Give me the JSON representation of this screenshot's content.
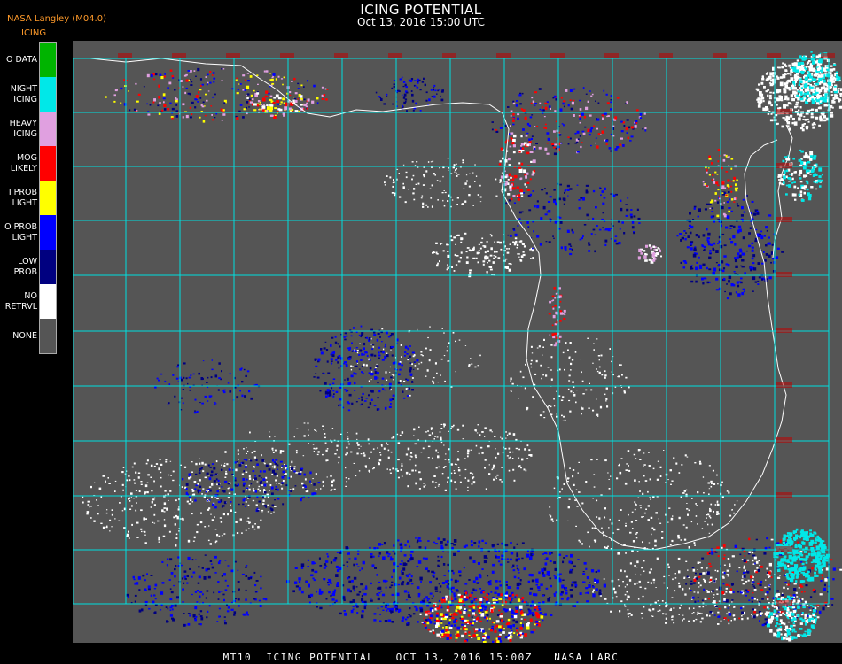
{
  "header": {
    "title": "ICING POTENTIAL",
    "subtitle": "Oct 13, 2016 15:00 UTC",
    "producer": "NASA Langley (M04.0)",
    "product": "ICING"
  },
  "legend": [
    {
      "label": "O DATA",
      "color": "#00b400"
    },
    {
      "label": "NIGHT\nICING",
      "color": "#00e8e8"
    },
    {
      "label": "HEAVY\nICING",
      "color": "#e0a0e0"
    },
    {
      "label": "MOG\nLIKELY",
      "color": "#ff0000"
    },
    {
      "label": "I PROB\nLIGHT",
      "color": "#ffff00"
    },
    {
      "label": "O PROB\nLIGHT",
      "color": "#0000ff"
    },
    {
      "label": "LOW\nPROB",
      "color": "#000080"
    },
    {
      "label": "NO\nRETRVL",
      "color": "#ffffff"
    },
    {
      "label": "NONE",
      "color": "#555555"
    }
  ],
  "colors": {
    "grid": "#00e0e0",
    "coast": "#ffffff",
    "background": "#555555",
    "grid_label": "#c00000"
  },
  "footer": "MT10  ICING POTENTIAL   OCT 13, 2016 15:00Z   NASA LARC"
}
